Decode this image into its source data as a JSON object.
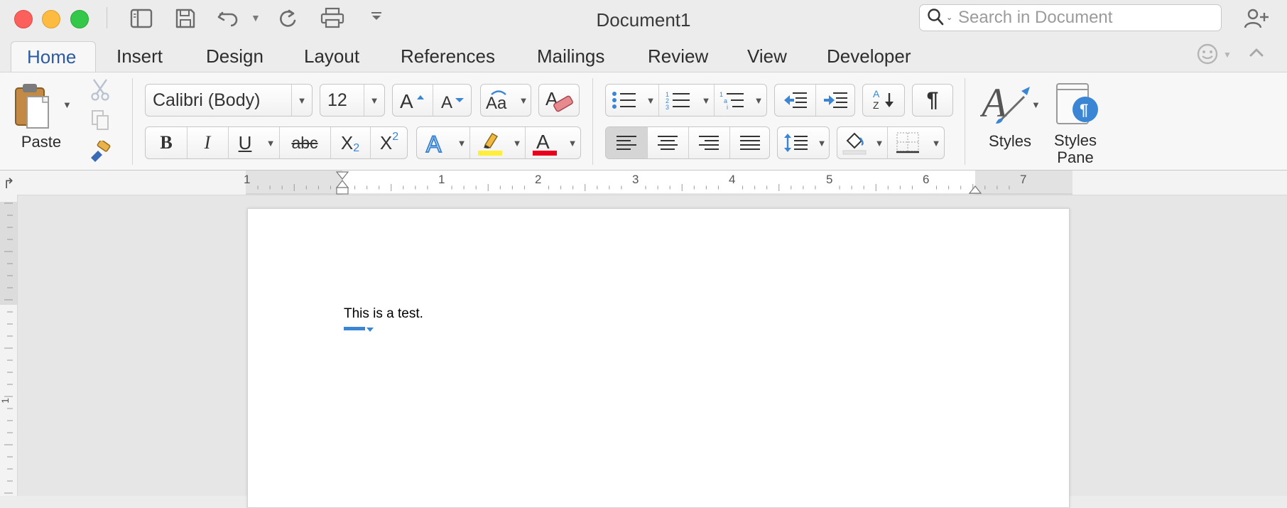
{
  "window": {
    "title": "Document1"
  },
  "titlebar": {
    "quick_access": [
      {
        "name": "sidebar-toggle",
        "icon": "sidebar-icon"
      },
      {
        "name": "save",
        "icon": "save-icon"
      },
      {
        "name": "undo",
        "icon": "undo-icon"
      },
      {
        "name": "redo",
        "icon": "redo-icon"
      },
      {
        "name": "print",
        "icon": "print-icon"
      },
      {
        "name": "customize",
        "icon": "more-chevron-icon"
      }
    ],
    "search_placeholder": "Search in Document",
    "share_icon": "add-person-icon"
  },
  "tabs": [
    "Home",
    "Insert",
    "Design",
    "Layout",
    "References",
    "Mailings",
    "Review",
    "View",
    "Developer"
  ],
  "active_tab": "Home",
  "ribbon": {
    "paste_label": "Paste",
    "font_name": "Calibri (Body)",
    "font_size": "12",
    "bold": "B",
    "italic": "I",
    "underline": "U",
    "strikethrough": "abc",
    "subscript_base": "X",
    "subscript_mark": "2",
    "superscript_base": "X",
    "superscript_mark": "2",
    "styles_label": "Styles",
    "styles_pane_label_1": "Styles",
    "styles_pane_label_2": "Pane",
    "pilcrow": "¶",
    "sort_a": "A",
    "sort_z": "Z"
  },
  "ruler": {
    "numbers": [
      "1",
      "1",
      "2",
      "3",
      "4",
      "5",
      "6",
      "7"
    ],
    "vertical_number": "1"
  },
  "document": {
    "body_text": "This is a test."
  },
  "colors": {
    "accent": "#2d5aa0",
    "close": "#fc605c",
    "minimize": "#fdbc40",
    "maximize": "#34c84a",
    "highlight": "#ffef3a",
    "font_color": "#e8001c",
    "icon_blue": "#3a86d4"
  }
}
